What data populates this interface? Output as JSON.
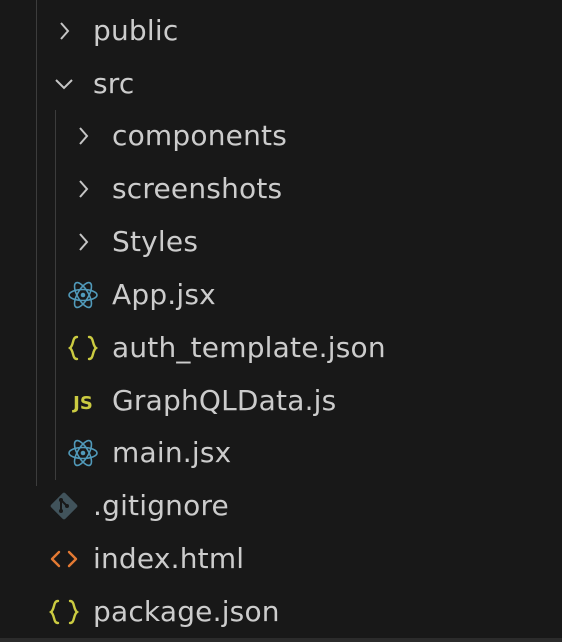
{
  "explorer": {
    "items": [
      {
        "label": "public",
        "kind": "folder",
        "state": "collapsed",
        "icon": "chevron-right-icon"
      },
      {
        "label": "src",
        "kind": "folder",
        "state": "expanded",
        "icon": "chevron-down-icon"
      },
      {
        "label": "components",
        "kind": "folder",
        "state": "collapsed",
        "icon": "chevron-right-icon"
      },
      {
        "label": "screenshots",
        "kind": "folder",
        "state": "collapsed",
        "icon": "chevron-right-icon"
      },
      {
        "label": "Styles",
        "kind": "folder",
        "state": "collapsed",
        "icon": "chevron-right-icon"
      },
      {
        "label": "App.jsx",
        "kind": "file",
        "icon": "react-icon"
      },
      {
        "label": "auth_template.json",
        "kind": "file",
        "icon": "json-braces-icon"
      },
      {
        "label": "GraphQLData.js",
        "kind": "file",
        "icon": "javascript-icon",
        "icon_text": "JS"
      },
      {
        "label": "main.jsx",
        "kind": "file",
        "icon": "react-icon"
      },
      {
        "label": ".gitignore",
        "kind": "file",
        "icon": "git-icon"
      },
      {
        "label": "index.html",
        "kind": "file",
        "icon": "html-brackets-icon"
      },
      {
        "label": "package.json",
        "kind": "file",
        "icon": "json-braces-icon"
      }
    ]
  },
  "colors": {
    "background": "#181818",
    "text": "#cccccc",
    "chevron": "#c5c5c5",
    "react": "#519aba",
    "json": "#cbcb41",
    "javascript": "#cbcb41",
    "git": "#41535b",
    "html": "#e37933",
    "guide": "#3c3c3c"
  }
}
